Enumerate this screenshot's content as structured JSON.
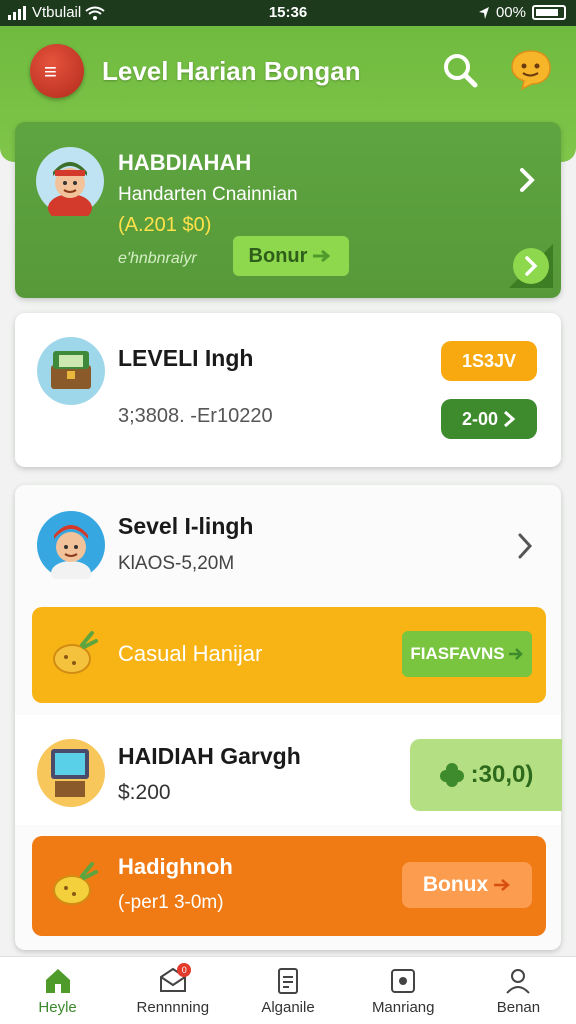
{
  "status_bar": {
    "carrier": "Vtbulail",
    "time": "15:36",
    "battery": "00%"
  },
  "header": {
    "title": "Level Harian Bongan"
  },
  "hero": {
    "name": "HABDIAHAH",
    "subtitle": "Handarten Cnainnian",
    "amount": "(A.201 $0)",
    "note": "e'hnbnraiyr",
    "bonus_label": "Bonur"
  },
  "level_card": {
    "title": "LEVELI Ingh",
    "range": "3;3808. -Er10220",
    "pill_top": "1S3JV",
    "pill_bottom": "2-00"
  },
  "group": {
    "title": "Sevel I-lingh",
    "subtitle": "KlAOS-5,20M",
    "casual_label": "Casual  Hanijar",
    "casual_button": "FIASFAVNS",
    "item_title": "HAIDIAH Garvgh",
    "item_price": "$:200",
    "green_amount": ":30,0)",
    "orange_title": "Hadighnoh",
    "orange_subtitle": "(-per1 3-0m)",
    "orange_button": "Bonux"
  },
  "bottom_nav": [
    {
      "label": "Heyle",
      "icon": "home-icon",
      "active": true
    },
    {
      "label": "Rennnning",
      "icon": "mail-icon",
      "badge": "0"
    },
    {
      "label": "Alganile",
      "icon": "document-icon"
    },
    {
      "label": "Manriang",
      "icon": "square-icon"
    },
    {
      "label": "Benan",
      "icon": "person-icon"
    }
  ],
  "colors": {
    "primary_green": "#6fba3f",
    "dark_green": "#3d8b2c",
    "yellow": "#f8b414",
    "orange": "#f07a14"
  }
}
